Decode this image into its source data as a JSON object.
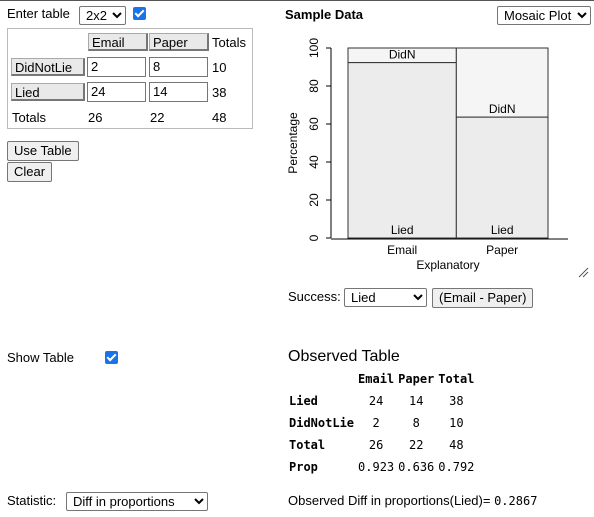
{
  "entry": {
    "label": "Enter table",
    "size_value": "2x2",
    "col_headers": [
      "Email",
      "Paper"
    ],
    "totals_header": "Totals",
    "rows": [
      {
        "label": "DidNotLie",
        "values": [
          "2",
          "8"
        ],
        "total": "10"
      },
      {
        "label": "Lied",
        "values": [
          "24",
          "14"
        ],
        "total": "38"
      }
    ],
    "totals_label": "Totals",
    "col_totals": [
      "26",
      "22"
    ],
    "grand_total": "48",
    "use_table_label": "Use Table",
    "clear_label": "Clear"
  },
  "plot": {
    "title": "Sample Data",
    "type_value": "Mosaic Plot",
    "success_label": "Success:",
    "success_value": "Lied",
    "diff_button_label": "(Email - Paper)"
  },
  "chart_data": {
    "type": "bar",
    "categories": [
      "Email",
      "Paper"
    ],
    "series": [
      {
        "name": "Lied",
        "values": [
          92.3,
          63.6
        ]
      },
      {
        "name": "DidN",
        "values": [
          7.7,
          36.4
        ]
      }
    ],
    "xlabel": "Explanatory",
    "ylabel": "Percentage",
    "ylim": [
      0,
      100
    ],
    "yticks": [
      "0",
      "20",
      "40",
      "60",
      "80",
      "100"
    ],
    "column_widths": [
      26,
      22
    ],
    "colors": {
      "lied": "#ececec",
      "didn": "#f5f5f5",
      "stroke": "#333333"
    }
  },
  "show_table": {
    "label": "Show Table"
  },
  "observed": {
    "title": "Observed Table",
    "headers": [
      "Email",
      "Paper",
      "Total"
    ],
    "rows": [
      {
        "label": "Lied",
        "values": [
          "24",
          "14",
          "38"
        ]
      },
      {
        "label": "DidNotLie",
        "values": [
          "2",
          "8",
          "10"
        ]
      },
      {
        "label": "Total",
        "values": [
          "26",
          "22",
          "48"
        ]
      },
      {
        "label": "Prop",
        "values": [
          "0.923",
          "0.636",
          "0.792"
        ]
      }
    ]
  },
  "statistic": {
    "label": "Statistic:",
    "value": "Diff in proportions",
    "observed_label": "Observed Diff in proportions(Lied)=",
    "observed_value": "0.2867"
  }
}
